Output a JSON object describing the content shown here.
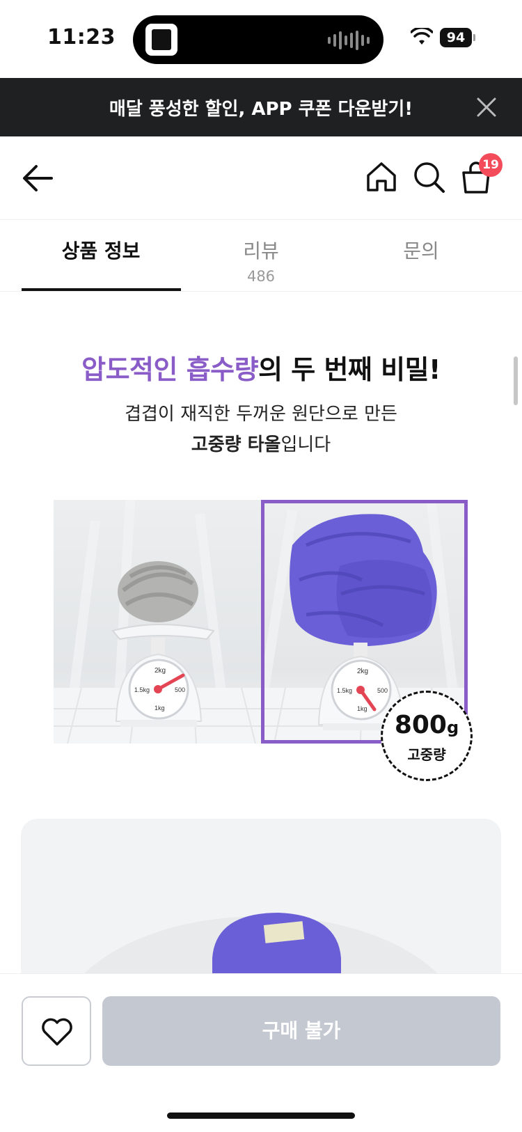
{
  "status_bar": {
    "time": "11:23",
    "battery": "94"
  },
  "promo_banner": {
    "text": "매달 풍성한 할인, APP 쿠폰 다운받기!"
  },
  "header": {
    "cart_count": "19"
  },
  "tabs": [
    {
      "label": "상품 정보",
      "count": ""
    },
    {
      "label": "리뷰",
      "count": "486"
    },
    {
      "label": "문의",
      "count": ""
    }
  ],
  "content": {
    "headline_accent": "압도적인 흡수량",
    "headline_rest": "의 두 번째 비밀!",
    "subline1": "겹겹이 재직한 두꺼운 원단으로 만든",
    "subline2_bold": "고중량 타올",
    "subline2_rest": "입니다",
    "weight_value": "800",
    "weight_unit": "g",
    "weight_label": "고중량",
    "scale_left": {
      "top": "2kg",
      "left": "1.5kg",
      "right": "500",
      "bottom": "1kg"
    },
    "scale_right": {
      "top": "2kg",
      "left": "1.5kg",
      "right": "500",
      "bottom": "1kg"
    }
  },
  "bottom_bar": {
    "buy_label": "구매 불가"
  },
  "colors": {
    "accent": "#8a5cc8",
    "banner_bg": "#1f2022",
    "badge": "#f44b5a",
    "disabled_button": "#c4c8d0"
  }
}
